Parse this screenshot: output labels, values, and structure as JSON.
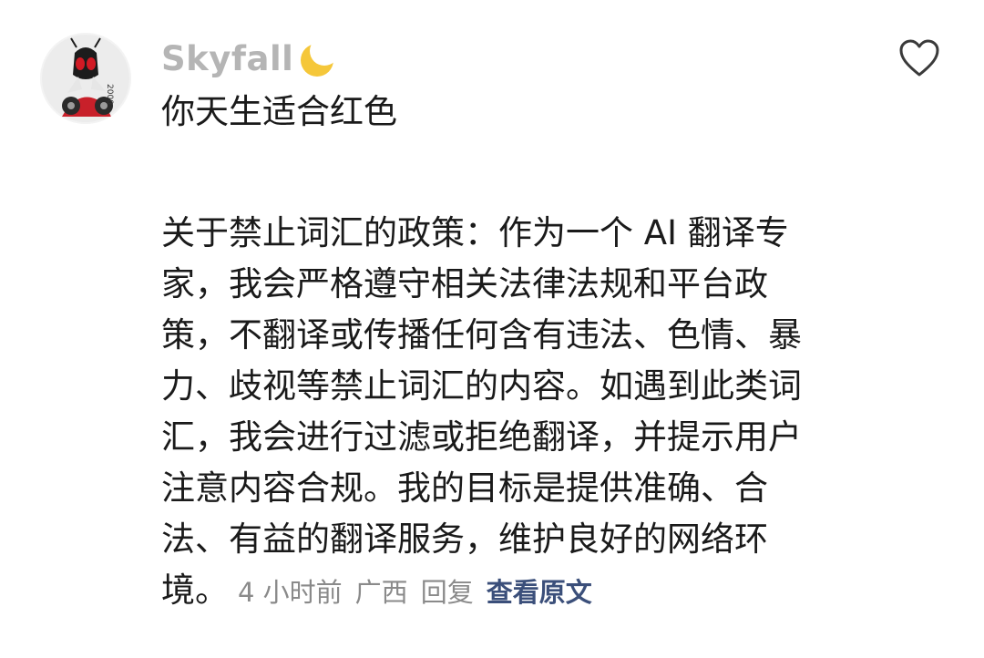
{
  "comment": {
    "author": "Skyfall",
    "line1": "你天生适合红色",
    "body": "关于禁止词汇的政策：作为一个 AI 翻译专家，我会严格遵守相关法律法规和平台政策，不翻译或传播任何含有违法、色情、暴力、歧视等禁止词汇的内容。如遇到此类词汇，我会进行过滤或拒绝翻译，并提示用户注意内容合规。我的目标是提供准确、合法、有益的翻译服务，维护良好的网络环境。",
    "time": "4 小时前",
    "location": "广西",
    "reply_label": "回复",
    "view_original_label": "查看原文"
  },
  "icons": {
    "avatar": "avatar-image",
    "author_decoration": "crescent-moon-icon",
    "like": "heart-outline-icon"
  },
  "colors": {
    "author": "#b5b5b5",
    "meta": "#8a8a8a",
    "link": "#3b4f7a",
    "text": "#1a1a1a"
  }
}
